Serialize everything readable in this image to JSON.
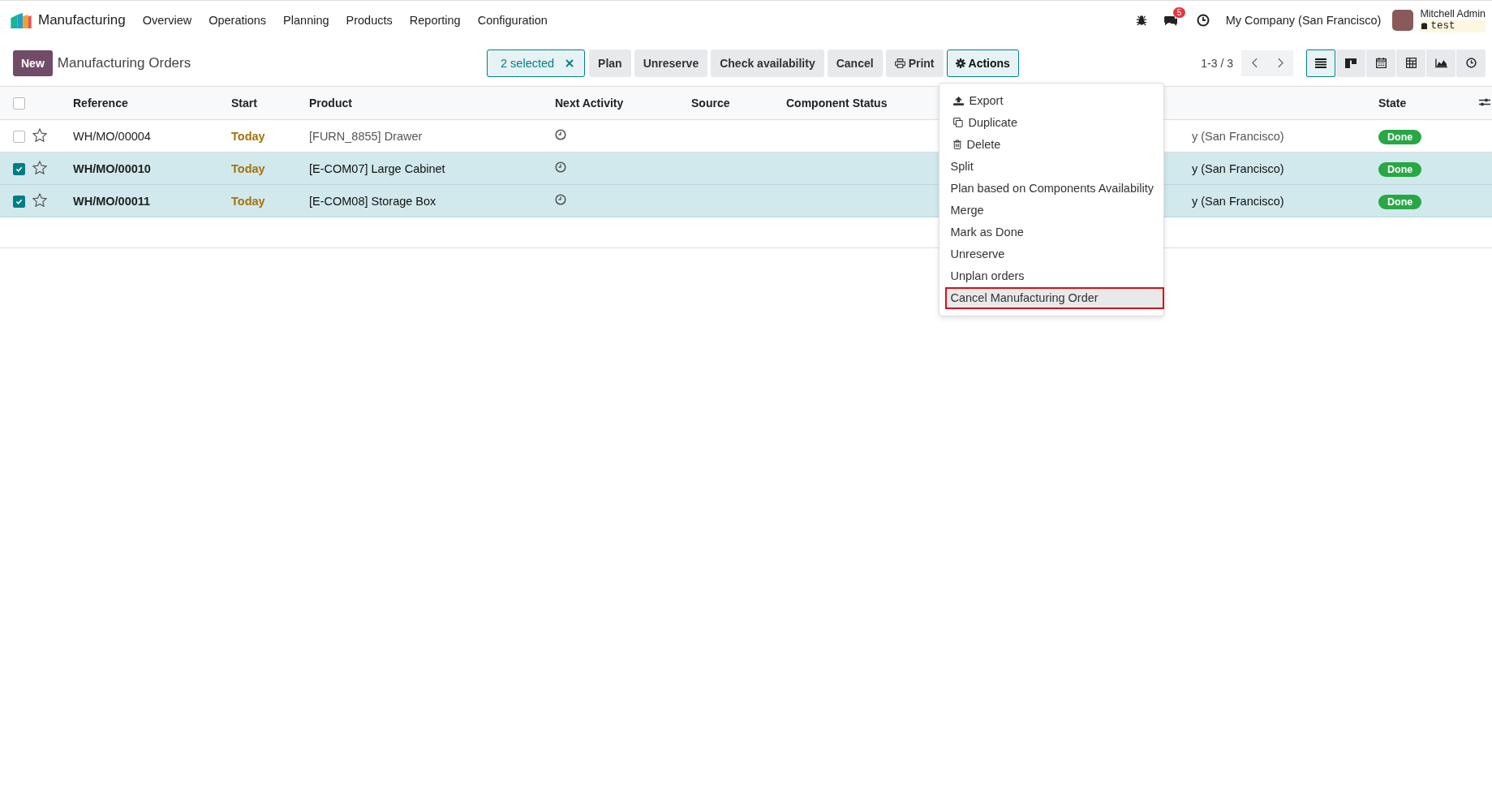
{
  "navbar": {
    "app_name": "Manufacturing",
    "menu": [
      "Overview",
      "Operations",
      "Planning",
      "Products",
      "Reporting",
      "Configuration"
    ],
    "messages_badge": "5",
    "company": "My Company (San Francisco)",
    "user_name": "Mitchell Admin",
    "database": "test"
  },
  "control_panel": {
    "new_button": "New",
    "title": "Manufacturing Orders",
    "selection": "2 selected",
    "buttons": [
      {
        "label": "Plan",
        "kind": "plain",
        "selected": false
      },
      {
        "label": "Unreserve",
        "kind": "plain",
        "selected": false
      },
      {
        "label": "Check availability",
        "kind": "plain",
        "selected": false
      },
      {
        "label": "Cancel",
        "kind": "plain",
        "selected": false
      },
      {
        "label": "Print",
        "kind": "print",
        "selected": false
      },
      {
        "label": "Actions",
        "kind": "actions",
        "selected": true
      }
    ],
    "pager": "1-3 / 3",
    "views": [
      {
        "kind": "list",
        "selected": true
      },
      {
        "kind": "kanban",
        "selected": false
      },
      {
        "kind": "calendar",
        "selected": false
      },
      {
        "kind": "pivot",
        "selected": false
      },
      {
        "kind": "graph",
        "selected": false
      },
      {
        "kind": "activity",
        "selected": false
      }
    ]
  },
  "table": {
    "all_selected": false,
    "columns": [
      "Reference",
      "Start",
      "Product",
      "Next Activity",
      "Source",
      "Component Status"
    ],
    "state_column": "State",
    "rows": [
      {
        "selected": false,
        "reference": "WH/MO/00004",
        "start": "Today",
        "product": "[FURN_8855] Drawer",
        "column_8": "y (San Francisco)",
        "state": "Done"
      },
      {
        "selected": true,
        "reference": "WH/MO/00010",
        "start": "Today",
        "product": "[E-COM07] Large Cabinet",
        "column_8": "y (San Francisco)",
        "state": "Done"
      },
      {
        "selected": true,
        "reference": "WH/MO/00011",
        "start": "Today",
        "product": "[E-COM08] Storage Box",
        "column_8": "y (San Francisco)",
        "state": "Done"
      }
    ]
  },
  "actions_menu": {
    "items": [
      {
        "label": "Export",
        "kind": "export",
        "selected": false
      },
      {
        "label": "Duplicate",
        "kind": "duplicate",
        "selected": false
      },
      {
        "label": "Delete",
        "kind": "delete",
        "selected": false
      },
      {
        "label": "Split",
        "kind": "text",
        "selected": false
      },
      {
        "label": "Plan based on Components Availability",
        "kind": "text",
        "selected": false
      },
      {
        "label": "Merge",
        "kind": "text",
        "selected": false
      },
      {
        "label": "Mark as Done",
        "kind": "text",
        "selected": false
      },
      {
        "label": "Unreserve",
        "kind": "text",
        "selected": false
      },
      {
        "label": "Unplan orders",
        "kind": "text",
        "selected": false
      },
      {
        "label": "Cancel Manufacturing Order",
        "kind": "text",
        "selected": true
      }
    ]
  }
}
